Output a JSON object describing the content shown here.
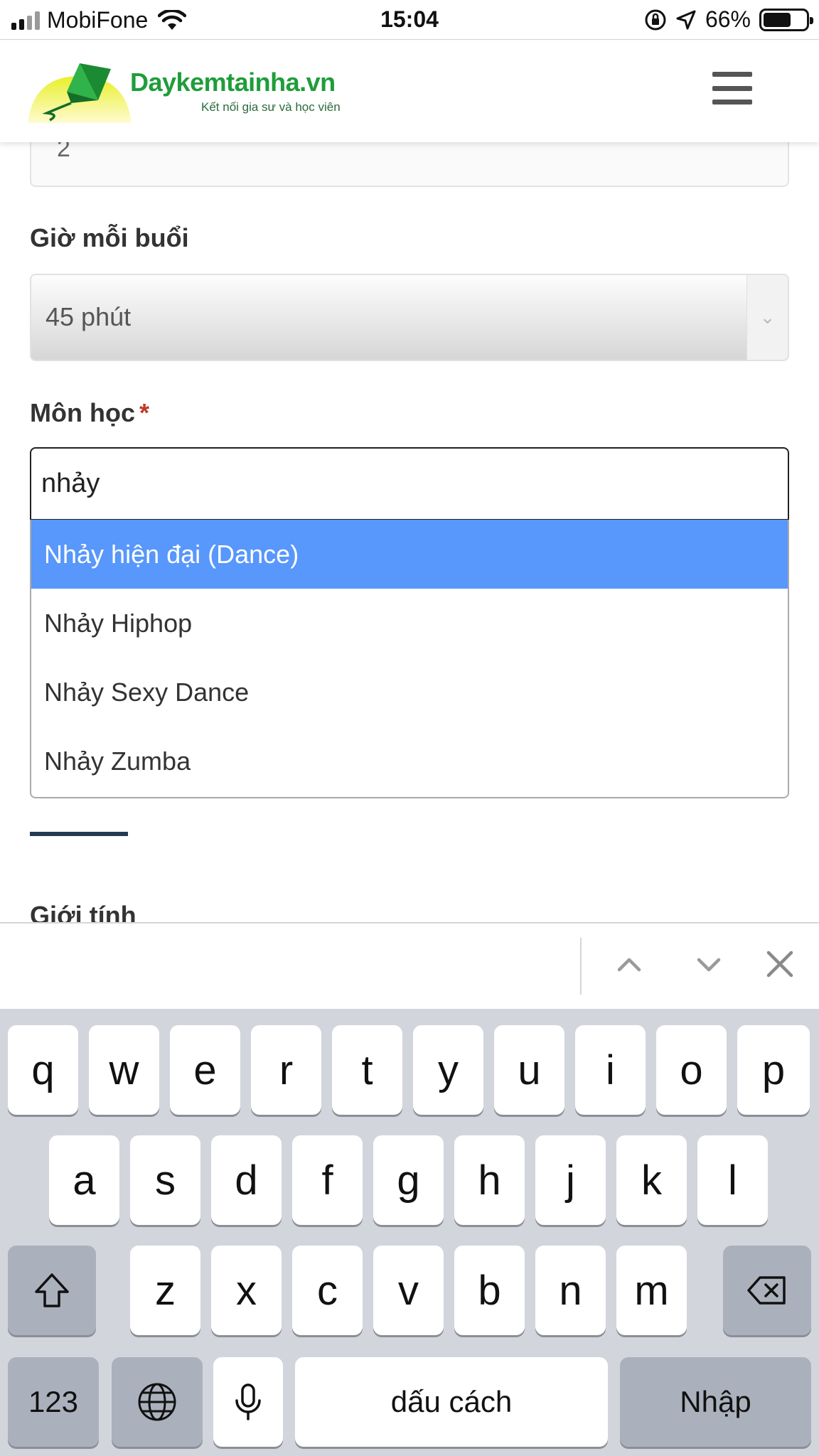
{
  "status_bar": {
    "carrier": "MobiFone",
    "time": "15:04",
    "battery_percent": "66%",
    "battery_level": 0.66
  },
  "header": {
    "logo_brand": "Daykemtainha.vn",
    "logo_tagline": "Kết nối gia sư và học viên"
  },
  "form": {
    "previous_field_value": "2",
    "session_length_label": "Giờ mỗi buổi",
    "session_length_value": "45 phút",
    "subject_label": "Môn học",
    "subject_required_mark": "*",
    "subject_query": "nhảy",
    "subject_options": [
      "Nhảy hiện đại (Dance)",
      "Nhảy Hiphop",
      "Nhảy Sexy Dance",
      "Nhảy Zumba"
    ],
    "highlighted_option": 0,
    "gender_label": "Giới tính"
  },
  "keyboard": {
    "row1": [
      "q",
      "w",
      "e",
      "r",
      "t",
      "y",
      "u",
      "i",
      "o",
      "p"
    ],
    "row2": [
      "a",
      "s",
      "d",
      "f",
      "g",
      "h",
      "j",
      "k",
      "l"
    ],
    "row3": [
      "z",
      "x",
      "c",
      "v",
      "b",
      "n",
      "m"
    ],
    "numbers_key": "123",
    "space_key": "dấu cách",
    "return_key": "Nhập"
  },
  "colors": {
    "highlight": "#5897fb",
    "brand_green": "#1f9d3a",
    "required": "#c0392b"
  }
}
